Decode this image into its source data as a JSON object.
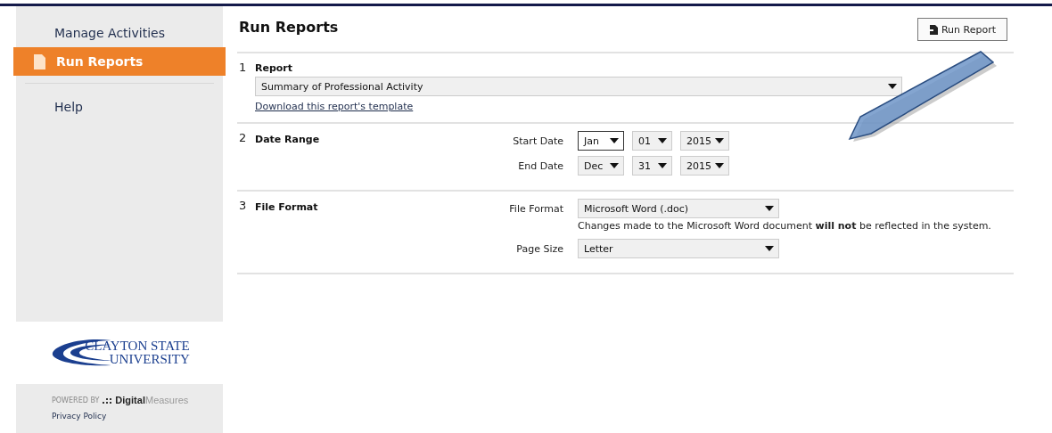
{
  "sidebar": {
    "items": [
      {
        "label": "Manage Activities",
        "selected": false
      },
      {
        "label": "Run Reports",
        "selected": true
      },
      {
        "label": "Help",
        "selected": false
      }
    ],
    "logo": {
      "line_1": "CLAYTON STATE",
      "line_2": "UNIVERSITY"
    },
    "footer": {
      "powered_by": "POWERED BY",
      "brand": "**Digital**Measures",
      "link": "Privacy Policy"
    }
  },
  "page": {
    "title": "Run Reports",
    "run_button": "Run Report"
  },
  "sections": [
    {
      "kind": "report",
      "number": "1",
      "title": "Report",
      "value": "Summary of Professional Activity",
      "link": "Download this report's template"
    },
    {
      "kind": "dates",
      "number": "2",
      "title": "Date Range",
      "rows": [
        {
          "label": "Start Date",
          "month": "Jan",
          "day": "01",
          "year": "2015",
          "focused": true
        },
        {
          "label": "End Date",
          "month": "Dec",
          "day": "31",
          "year": "2015",
          "focused": false
        }
      ]
    },
    {
      "kind": "format",
      "number": "3",
      "title": "File Format",
      "rows": [
        {
          "label": "File Format",
          "value": "Microsoft Word (.doc)",
          "note": "Changes made to the Microsoft Word document **will not** be reflected in the system."
        },
        {
          "label": "Page Size",
          "value": "Letter"
        }
      ]
    }
  ]
}
